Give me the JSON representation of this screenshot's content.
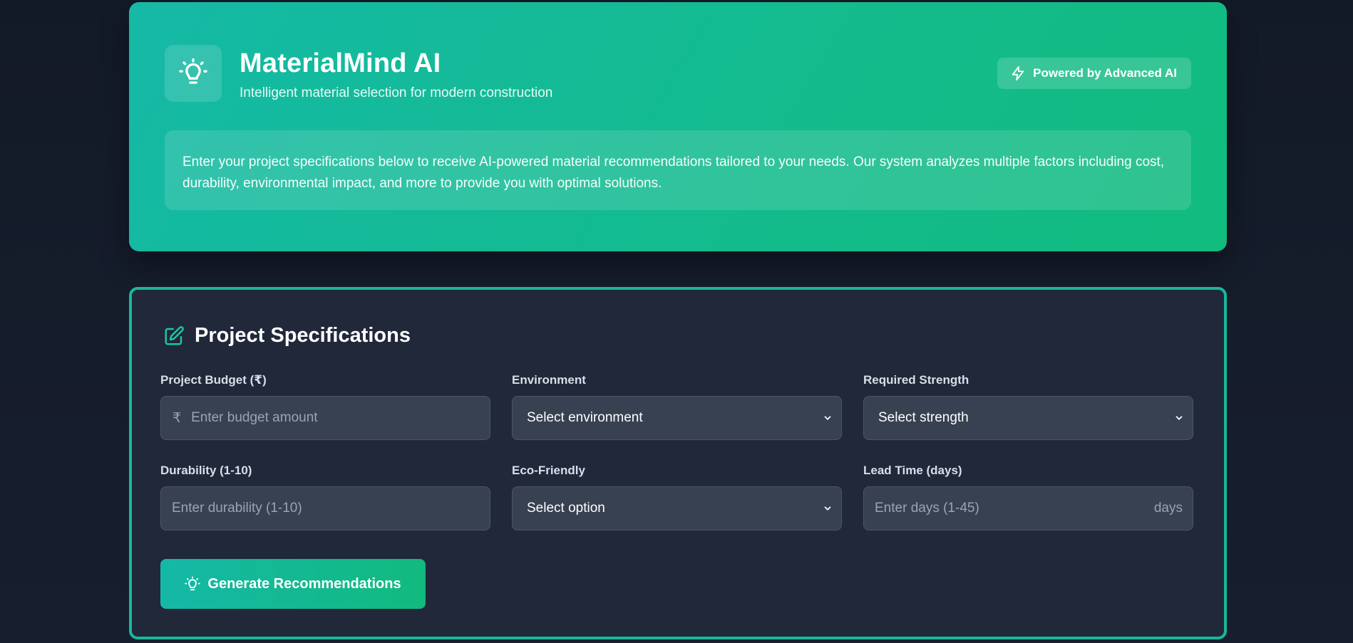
{
  "header": {
    "app_title": "MaterialMind AI",
    "subtitle": "Intelligent material selection for modern construction",
    "badge_label": "Powered by Advanced AI",
    "logo_icon": "lightbulb-icon",
    "badge_icon": "lightning-icon",
    "description": "Enter your project specifications below to receive AI-powered material recommendations tailored to your needs. Our system analyzes multiple factors including cost, durability, environmental impact, and more to provide you with optimal solutions."
  },
  "specs": {
    "title": "Project Specifications",
    "title_icon": "edit-icon",
    "fields": {
      "budget": {
        "label": "Project Budget (₹)",
        "prefix": "₹",
        "placeholder": "Enter budget amount",
        "value": ""
      },
      "environment": {
        "label": "Environment",
        "selected": "Select environment"
      },
      "strength": {
        "label": "Required Strength",
        "selected": "Select strength"
      },
      "durability": {
        "label": "Durability (1-10)",
        "placeholder": "Enter durability (1-10)",
        "value": ""
      },
      "eco": {
        "label": "Eco-Friendly",
        "selected": "Select option"
      },
      "lead_time": {
        "label": "Lead Time (days)",
        "placeholder": "Enter days (1-45)",
        "suffix": "days",
        "value": ""
      }
    },
    "generate_label": "Generate Recommendations",
    "generate_icon": "lightbulb-icon"
  },
  "colors": {
    "accent": "#14b8a6",
    "accent_green": "#10b981",
    "page_bg": "#161c2b",
    "card_bg": "#20283a",
    "input_bg": "#374151"
  }
}
